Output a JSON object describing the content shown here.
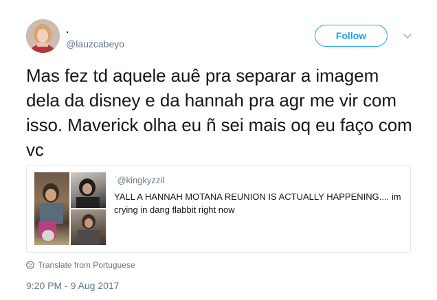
{
  "author": {
    "display_name": ".",
    "handle": "@lauzcabeyo"
  },
  "follow_label": "Follow",
  "tweet_text": "Mas fez td aquele auê pra separar a imagem dela da disney e da hannah pra agr me vir com isso. Maverick olha eu ñ sei mais oq eu faço com vc",
  "quoted": {
    "handle": "˙@kingkyzzil",
    "text": "YALL A HANNAH MOTANA REUNION IS ACTUALLY HAPPENING.... im crying in dang flabbit right now"
  },
  "translate_label": "Translate from Portuguese",
  "timestamp": "9:20 PM - 9 Aug 2017",
  "icons": {
    "chevron": "chevron-down-icon",
    "globe": "globe-icon"
  },
  "colors": {
    "accent": "#1da1f2",
    "secondary_text": "#657786",
    "border": "#e1e8ed"
  }
}
